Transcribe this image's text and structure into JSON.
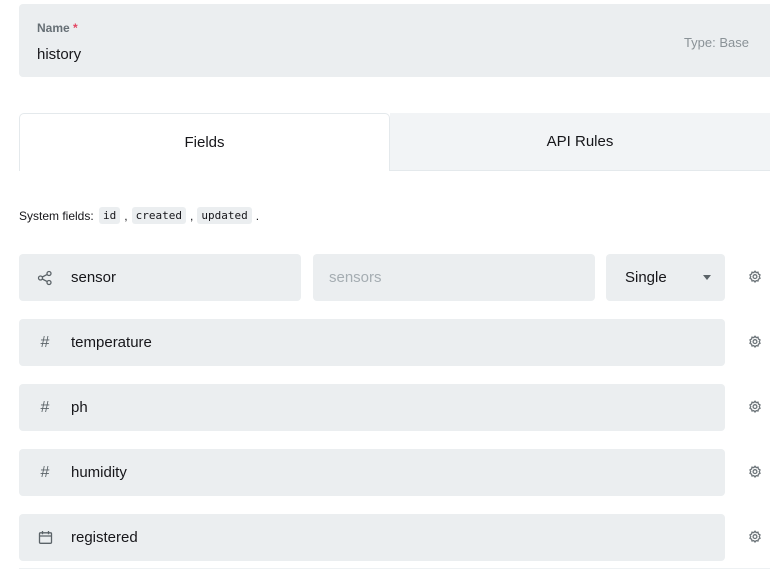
{
  "collection": {
    "name_label": "Name",
    "required_mark": "*",
    "name_value": "history",
    "type_label": "Type: Base"
  },
  "tabs": [
    {
      "label": "Fields",
      "active": true
    },
    {
      "label": "API Rules",
      "active": false
    }
  ],
  "system_fields": {
    "prefix": "System fields:",
    "items": [
      "id",
      "created",
      "updated"
    ],
    "separator": ",",
    "suffix": "."
  },
  "fields": [
    {
      "name": "sensor",
      "icon": "relation-icon",
      "collection_placeholder": "sensors",
      "select_value": "Single"
    },
    {
      "name": "temperature",
      "icon": "number-icon",
      "icon_glyph": "#"
    },
    {
      "name": "ph",
      "icon": "number-icon",
      "icon_glyph": "#"
    },
    {
      "name": "humidity",
      "icon": "number-icon",
      "icon_glyph": "#"
    },
    {
      "name": "registered",
      "icon": "calendar-icon"
    }
  ],
  "colors": {
    "field_bg": "#ebeef0",
    "required": "#e34562",
    "muted_text": "#8a9297"
  }
}
